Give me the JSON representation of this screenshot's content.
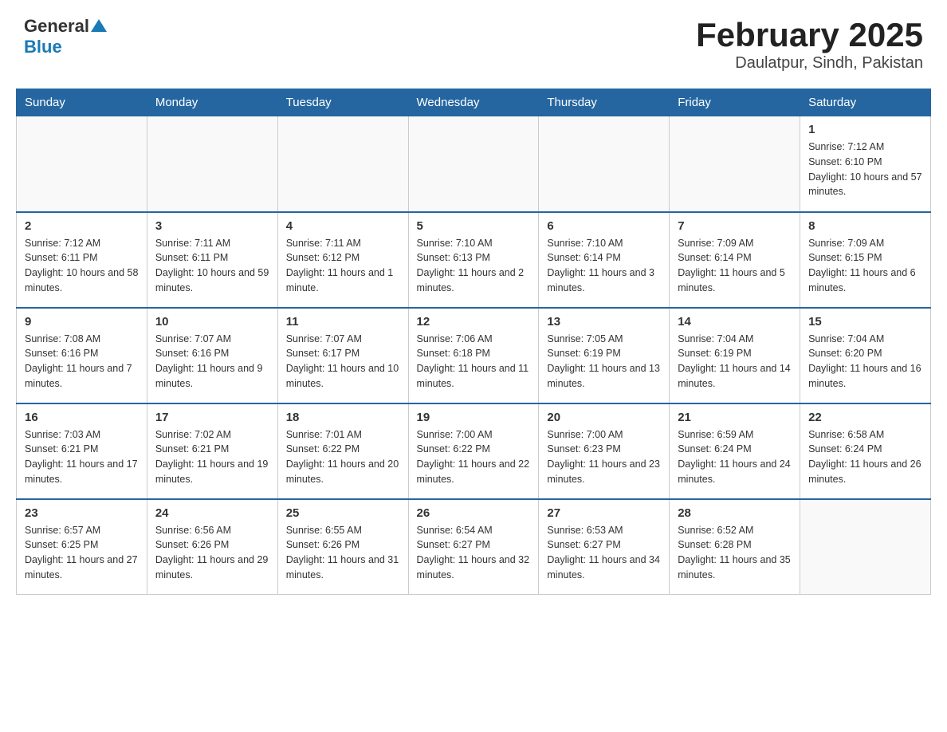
{
  "header": {
    "logo": {
      "general": "General",
      "blue": "Blue",
      "triangle": "▲"
    },
    "title": "February 2025",
    "subtitle": "Daulatpur, Sindh, Pakistan"
  },
  "calendar": {
    "days_of_week": [
      "Sunday",
      "Monday",
      "Tuesday",
      "Wednesday",
      "Thursday",
      "Friday",
      "Saturday"
    ],
    "weeks": [
      [
        {
          "day": "",
          "info": ""
        },
        {
          "day": "",
          "info": ""
        },
        {
          "day": "",
          "info": ""
        },
        {
          "day": "",
          "info": ""
        },
        {
          "day": "",
          "info": ""
        },
        {
          "day": "",
          "info": ""
        },
        {
          "day": "1",
          "info": "Sunrise: 7:12 AM\nSunset: 6:10 PM\nDaylight: 10 hours and 57 minutes."
        }
      ],
      [
        {
          "day": "2",
          "info": "Sunrise: 7:12 AM\nSunset: 6:11 PM\nDaylight: 10 hours and 58 minutes."
        },
        {
          "day": "3",
          "info": "Sunrise: 7:11 AM\nSunset: 6:11 PM\nDaylight: 10 hours and 59 minutes."
        },
        {
          "day": "4",
          "info": "Sunrise: 7:11 AM\nSunset: 6:12 PM\nDaylight: 11 hours and 1 minute."
        },
        {
          "day": "5",
          "info": "Sunrise: 7:10 AM\nSunset: 6:13 PM\nDaylight: 11 hours and 2 minutes."
        },
        {
          "day": "6",
          "info": "Sunrise: 7:10 AM\nSunset: 6:14 PM\nDaylight: 11 hours and 3 minutes."
        },
        {
          "day": "7",
          "info": "Sunrise: 7:09 AM\nSunset: 6:14 PM\nDaylight: 11 hours and 5 minutes."
        },
        {
          "day": "8",
          "info": "Sunrise: 7:09 AM\nSunset: 6:15 PM\nDaylight: 11 hours and 6 minutes."
        }
      ],
      [
        {
          "day": "9",
          "info": "Sunrise: 7:08 AM\nSunset: 6:16 PM\nDaylight: 11 hours and 7 minutes."
        },
        {
          "day": "10",
          "info": "Sunrise: 7:07 AM\nSunset: 6:16 PM\nDaylight: 11 hours and 9 minutes."
        },
        {
          "day": "11",
          "info": "Sunrise: 7:07 AM\nSunset: 6:17 PM\nDaylight: 11 hours and 10 minutes."
        },
        {
          "day": "12",
          "info": "Sunrise: 7:06 AM\nSunset: 6:18 PM\nDaylight: 11 hours and 11 minutes."
        },
        {
          "day": "13",
          "info": "Sunrise: 7:05 AM\nSunset: 6:19 PM\nDaylight: 11 hours and 13 minutes."
        },
        {
          "day": "14",
          "info": "Sunrise: 7:04 AM\nSunset: 6:19 PM\nDaylight: 11 hours and 14 minutes."
        },
        {
          "day": "15",
          "info": "Sunrise: 7:04 AM\nSunset: 6:20 PM\nDaylight: 11 hours and 16 minutes."
        }
      ],
      [
        {
          "day": "16",
          "info": "Sunrise: 7:03 AM\nSunset: 6:21 PM\nDaylight: 11 hours and 17 minutes."
        },
        {
          "day": "17",
          "info": "Sunrise: 7:02 AM\nSunset: 6:21 PM\nDaylight: 11 hours and 19 minutes."
        },
        {
          "day": "18",
          "info": "Sunrise: 7:01 AM\nSunset: 6:22 PM\nDaylight: 11 hours and 20 minutes."
        },
        {
          "day": "19",
          "info": "Sunrise: 7:00 AM\nSunset: 6:22 PM\nDaylight: 11 hours and 22 minutes."
        },
        {
          "day": "20",
          "info": "Sunrise: 7:00 AM\nSunset: 6:23 PM\nDaylight: 11 hours and 23 minutes."
        },
        {
          "day": "21",
          "info": "Sunrise: 6:59 AM\nSunset: 6:24 PM\nDaylight: 11 hours and 24 minutes."
        },
        {
          "day": "22",
          "info": "Sunrise: 6:58 AM\nSunset: 6:24 PM\nDaylight: 11 hours and 26 minutes."
        }
      ],
      [
        {
          "day": "23",
          "info": "Sunrise: 6:57 AM\nSunset: 6:25 PM\nDaylight: 11 hours and 27 minutes."
        },
        {
          "day": "24",
          "info": "Sunrise: 6:56 AM\nSunset: 6:26 PM\nDaylight: 11 hours and 29 minutes."
        },
        {
          "day": "25",
          "info": "Sunrise: 6:55 AM\nSunset: 6:26 PM\nDaylight: 11 hours and 31 minutes."
        },
        {
          "day": "26",
          "info": "Sunrise: 6:54 AM\nSunset: 6:27 PM\nDaylight: 11 hours and 32 minutes."
        },
        {
          "day": "27",
          "info": "Sunrise: 6:53 AM\nSunset: 6:27 PM\nDaylight: 11 hours and 34 minutes."
        },
        {
          "day": "28",
          "info": "Sunrise: 6:52 AM\nSunset: 6:28 PM\nDaylight: 11 hours and 35 minutes."
        },
        {
          "day": "",
          "info": ""
        }
      ]
    ]
  }
}
